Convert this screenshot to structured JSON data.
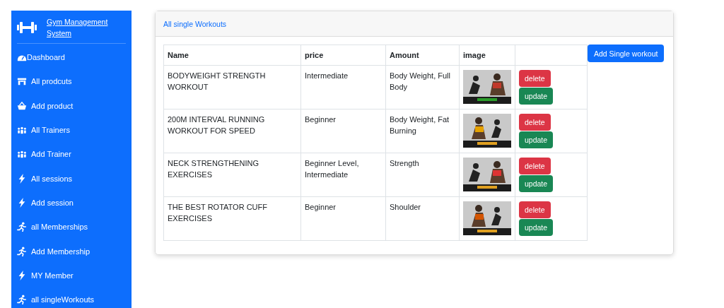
{
  "sidebar": {
    "brand": "Gym Management System",
    "items": [
      {
        "label": "Dashboard",
        "kind": "gauge"
      },
      {
        "label": "All prodcuts",
        "kind": "store"
      },
      {
        "label": "Add product",
        "kind": "basket"
      },
      {
        "label": "All Trainers",
        "kind": "people"
      },
      {
        "label": "Add Trainer",
        "kind": "people"
      },
      {
        "label": "All sessions",
        "kind": "bolt"
      },
      {
        "label": "Add session",
        "kind": "bolt"
      },
      {
        "label": "all Memberships",
        "kind": "runner"
      },
      {
        "label": "Add Membership",
        "kind": "runner"
      },
      {
        "label": "MY Member",
        "kind": "bolt"
      },
      {
        "label": "all singleWorkouts",
        "kind": "runner"
      }
    ]
  },
  "card": {
    "title": "All single Workouts"
  },
  "table": {
    "columns": [
      "Name",
      "price",
      "Amount",
      "image"
    ],
    "rows": [
      {
        "name": "BODYWEIGHT STRENGTH WORKOUT",
        "price": "Intermediate",
        "amount": "Body Weight, Full Body",
        "actions": [
          "delete",
          "update"
        ]
      },
      {
        "name": "200M INTERVAL RUNNING WORKOUT FOR SPEED",
        "price": "Beginner",
        "amount": "Body Weight, Fat Burning",
        "actions": [
          "delete",
          "update"
        ]
      },
      {
        "name": "NECK STRENGTHENING EXERCISES",
        "price": "Beginner Level, Intermediate",
        "amount": "Strength",
        "actions": [
          "delete",
          "update"
        ]
      },
      {
        "name": "THE BEST ROTATOR CUFF EXERCISES",
        "price": "Beginner",
        "amount": "Shoulder",
        "actions": [
          "delete",
          "update"
        ]
      }
    ]
  },
  "add_button": "Add Single workout"
}
